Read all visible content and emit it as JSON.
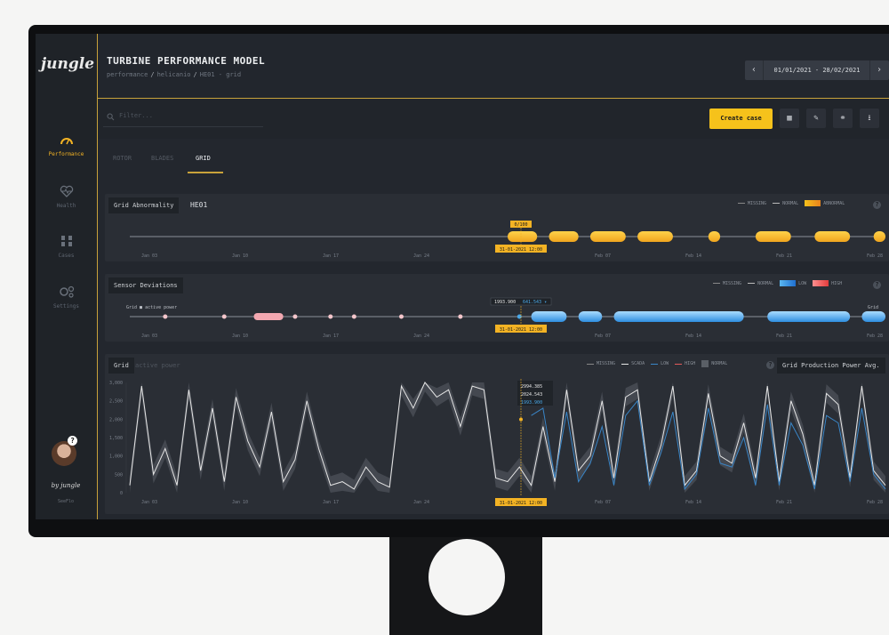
{
  "app": {
    "logo": "jungle",
    "title": "TURBINE PERFORMANCE MODEL",
    "breadcrumb": [
      "performance",
      "helicanio",
      "HE01 - grid"
    ],
    "date_range": "01/01/2021 - 28/02/2021"
  },
  "sidebar": {
    "items": [
      {
        "label": "Performance",
        "icon": "gauge-icon",
        "active": true
      },
      {
        "label": "Health",
        "icon": "heart-icon",
        "active": false
      },
      {
        "label": "Cases",
        "icon": "cases-icon",
        "active": false
      },
      {
        "label": "Settings",
        "icon": "gears-icon",
        "active": false
      }
    ],
    "footer_logo": "by jungle",
    "footer_sub": "SeeFlo"
  },
  "toolbar": {
    "filter_placeholder": "Filter...",
    "create_case_label": "Create case",
    "icons": [
      "grid-icon",
      "edit-icon",
      "link-icon",
      "download-icon"
    ]
  },
  "tabs": [
    "ROTOR",
    "BLADES",
    "GRID"
  ],
  "active_tab": "GRID",
  "x_ticks": [
    "Jan 03",
    "Jan 10",
    "Jan 17",
    "Jan 24",
    "Feb 07",
    "Feb 14",
    "Feb 21",
    "Feb 28"
  ],
  "cursor_label": "31-01-2021 12:00",
  "panels": {
    "abnormality": {
      "title": "Grid Abnormality",
      "asset": "HE01",
      "legend": [
        "MISSING",
        "NORMAL",
        "ABNORMAL"
      ],
      "cursor_value": "0/100"
    },
    "deviations": {
      "title": "Sensor Deviations",
      "legend": [
        "MISSING",
        "NORMAL",
        "LOW",
        "HIGH"
      ],
      "row_label": "Grid ■ active power",
      "row_label_right": "Grid",
      "cursor_values": [
        "1993.900",
        "641.543 ▾"
      ]
    },
    "grid": {
      "title": "Grid",
      "subtitle": "active power",
      "legend": [
        "MISSING",
        "SCADA",
        "LOW",
        "HIGH",
        "NORMAL"
      ],
      "dropdown": "Grid Production Power Avg.",
      "tooltip": [
        "2994.385",
        "2024.543",
        "1993.900"
      ]
    }
  },
  "chart_data": {
    "type": "line",
    "title": "Grid active power",
    "y_ticks": [
      "3,000",
      "2,500",
      "2,000",
      "1,500",
      "1,000",
      "500",
      "0"
    ],
    "ylim": [
      0,
      3000
    ],
    "x_domain_days": [
      1,
      59
    ],
    "series": [
      {
        "name": "SCADA",
        "color": "#e6e6e6",
        "values": [
          200,
          2900,
          500,
          1200,
          200,
          2800,
          600,
          2300,
          300,
          2600,
          1400,
          700,
          2200,
          300,
          900,
          2500,
          1200,
          200,
          300,
          100,
          700,
          300,
          150,
          2900,
          2300,
          3000,
          2600,
          2800,
          1800,
          2900,
          2800,
          400,
          300,
          700,
          200,
          1800,
          300,
          2800,
          600,
          1000,
          2500,
          400,
          2600,
          2800,
          300,
          1300,
          2900,
          200,
          600,
          2700,
          1000,
          800,
          1900,
          400,
          2900,
          300,
          2500,
          1600,
          200,
          2700,
          2400,
          400,
          2900,
          600,
          200
        ]
      },
      {
        "name": "LOW",
        "color": "#3a86c8",
        "values": [
          null,
          null,
          null,
          null,
          null,
          null,
          null,
          null,
          null,
          null,
          null,
          null,
          null,
          null,
          null,
          null,
          null,
          null,
          null,
          null,
          null,
          null,
          null,
          null,
          null,
          null,
          null,
          null,
          null,
          null,
          null,
          null,
          null,
          null,
          2100,
          2300,
          400,
          2200,
          300,
          800,
          1800,
          200,
          2100,
          2500,
          200,
          1100,
          2200,
          100,
          500,
          2300,
          800,
          700,
          1500,
          200,
          2400,
          200,
          1900,
          1300,
          100,
          2100,
          1900,
          300,
          2300,
          500,
          100
        ]
      }
    ],
    "abnormality_segments": [
      [
        32,
        34.5
      ],
      [
        35.5,
        38
      ],
      [
        39,
        42
      ],
      [
        43,
        46
      ],
      [
        49,
        50
      ],
      [
        53,
        56
      ],
      [
        58,
        61
      ],
      [
        63,
        64
      ]
    ],
    "deviation_points_normal": [
      [
        3,
        "p"
      ],
      [
        8,
        "p"
      ],
      [
        12,
        "p"
      ],
      [
        14,
        "p"
      ],
      [
        17,
        "p"
      ],
      [
        19,
        "p"
      ],
      [
        23,
        "p"
      ],
      [
        28,
        "p"
      ],
      [
        33,
        "b"
      ]
    ],
    "deviation_segments_low": [
      [
        34,
        37
      ],
      [
        38,
        40
      ],
      [
        41,
        52
      ],
      [
        54,
        61
      ],
      [
        62,
        65
      ]
    ]
  }
}
